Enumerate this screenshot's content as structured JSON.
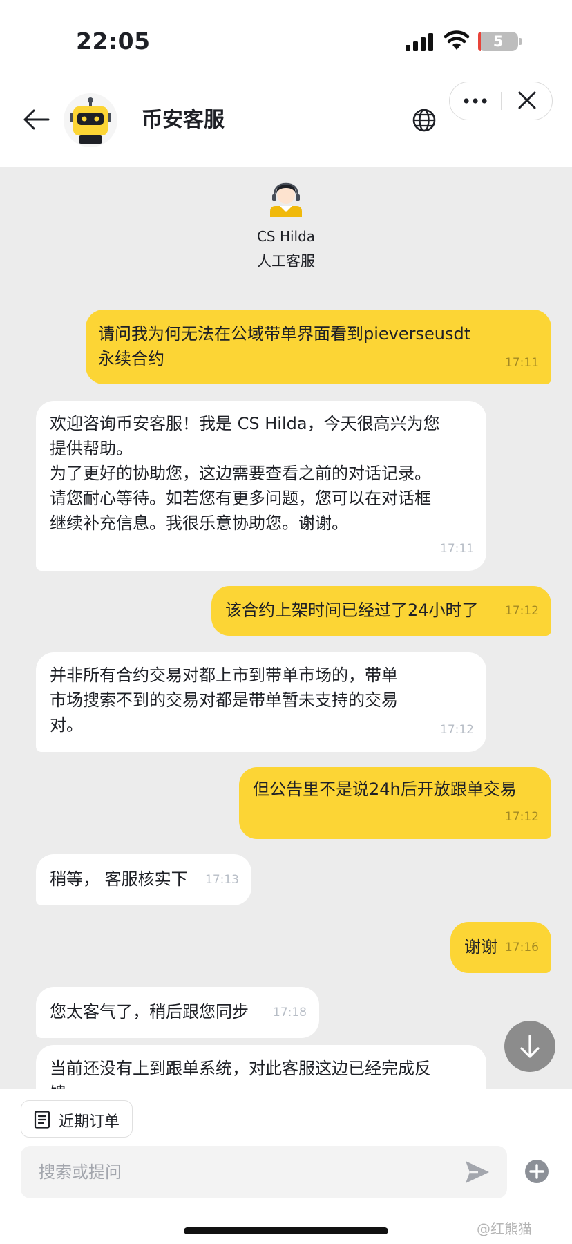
{
  "status_bar": {
    "time": "22:05",
    "battery": "5",
    "battery_level": 0.05
  },
  "header": {
    "title": "币安客服"
  },
  "agent": {
    "name": "CS Hilda",
    "role": "人工客服"
  },
  "messages": [
    {
      "from": "user",
      "text": "请问我为何无法在公域带单界面看到pieverseusdt\n永续合约",
      "time": "17:11"
    },
    {
      "from": "agent",
      "text": "欢迎咨询币安客服！我是 CS Hilda，今天很高兴为您\n提供帮助。\n为了更好的协助您，这边需要查看之前的对话记录。\n请您耐心等待。如若您有更多问题，您可以在对话框\n继续补充信息。我很乐意协助您。谢谢。",
      "time": "17:11"
    },
    {
      "from": "user",
      "text": "该合约上架时间已经过了24小时了",
      "time": "17:12"
    },
    {
      "from": "agent",
      "text": "并非所有合约交易对都上市到带单市场的，带单\n市场搜索不到的交易对都是带单暂未支持的交易\n对。",
      "time": "17:12"
    },
    {
      "from": "user",
      "text": "但公告里不是说24h后开放跟单交易",
      "time": "17:12"
    },
    {
      "from": "agent",
      "text": "稍等， 客服核实下",
      "time": "17:13"
    },
    {
      "from": "user",
      "text": "谢谢",
      "time": "17:16"
    },
    {
      "from": "agent",
      "text": "您太客气了，稍后跟您同步",
      "time": "17:18"
    },
    {
      "from": "agent",
      "text": "当前还没有上到跟单系统，对此客服这边已经完成反\n馈。",
      "time": ""
    }
  ],
  "bottom": {
    "recent_orders": "近期订单",
    "input_placeholder": "搜索或提问"
  },
  "watermark": "@红熊猫",
  "colors": {
    "brand_yellow": "#FCD535",
    "chat_bg": "#ECECEC",
    "agent_bubble": "#FFFFFF"
  }
}
